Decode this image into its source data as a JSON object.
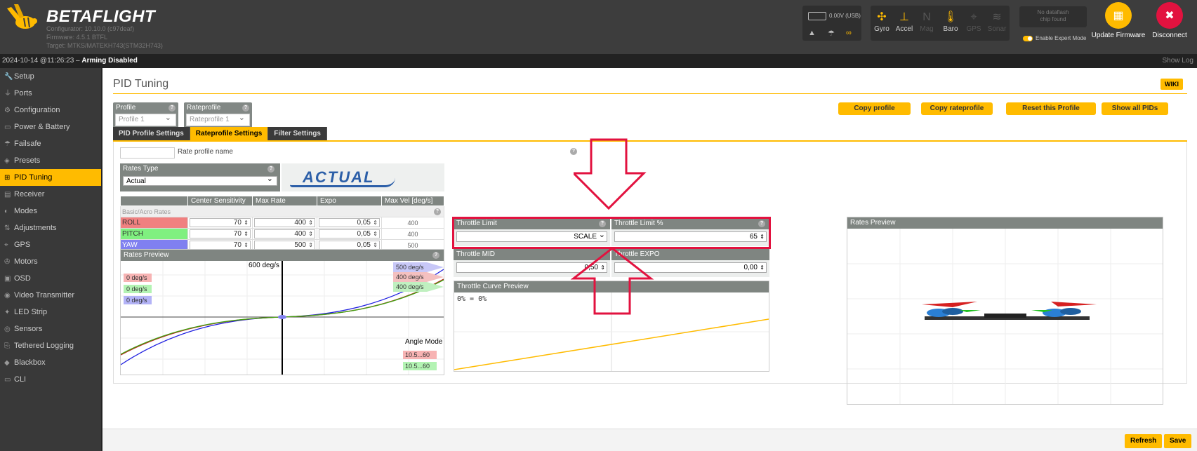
{
  "app": {
    "logo_text": "BETAFLIGHT",
    "configurator": "Configurator: 10.10.0 (c97deaf)",
    "firmware": "Firmware: 4.5.1 BTFL",
    "target": "Target: MTKS/MATEKH743(STM32H743)"
  },
  "battery": {
    "text": "0.00V (USB)"
  },
  "sensors": [
    {
      "label": "Gyro",
      "icon": "gyro-icon",
      "active": true
    },
    {
      "label": "Accel",
      "icon": "accel-icon",
      "active": true
    },
    {
      "label": "Mag",
      "icon": "mag-icon",
      "active": false
    },
    {
      "label": "Baro",
      "icon": "baro-icon",
      "active": true
    },
    {
      "label": "GPS",
      "icon": "gps-icon",
      "active": false
    },
    {
      "label": "Sonar",
      "icon": "sonar-icon",
      "active": false
    }
  ],
  "dataflash": {
    "line1": "No dataflash",
    "line2": "chip found"
  },
  "expert_mode": {
    "label": "Enable Expert Mode"
  },
  "header_buttons": {
    "update": "Update Firmware",
    "disconnect": "Disconnect"
  },
  "status": {
    "datetime": "2024-10-14 @11:26:23 –",
    "arming": "Arming Disabled",
    "show_log": "Show Log"
  },
  "sidebar": {
    "items": [
      {
        "label": "Setup",
        "icon": "wrench-icon"
      },
      {
        "label": "Ports",
        "icon": "plug-icon"
      },
      {
        "label": "Configuration",
        "icon": "gear-icon"
      },
      {
        "label": "Power & Battery",
        "icon": "battery-icon"
      },
      {
        "label": "Failsafe",
        "icon": "parachute-icon"
      },
      {
        "label": "Presets",
        "icon": "presets-icon"
      },
      {
        "label": "PID Tuning",
        "icon": "pid-icon",
        "active": true
      },
      {
        "label": "Receiver",
        "icon": "receiver-icon"
      },
      {
        "label": "Modes",
        "icon": "modes-icon"
      },
      {
        "label": "Adjustments",
        "icon": "adjustments-icon"
      },
      {
        "label": "GPS",
        "icon": "gps-icon"
      },
      {
        "label": "Motors",
        "icon": "motor-icon"
      },
      {
        "label": "OSD",
        "icon": "osd-icon"
      },
      {
        "label": "Video Transmitter",
        "icon": "vtx-icon"
      },
      {
        "label": "LED Strip",
        "icon": "led-icon"
      },
      {
        "label": "Sensors",
        "icon": "sensors-icon"
      },
      {
        "label": "Tethered Logging",
        "icon": "tethered-icon"
      },
      {
        "label": "Blackbox",
        "icon": "blackbox-icon"
      },
      {
        "label": "CLI",
        "icon": "cli-icon"
      }
    ]
  },
  "page": {
    "title": "PID Tuning",
    "wiki": "WIKI"
  },
  "profile": {
    "label": "Profile",
    "value": "Profile 1"
  },
  "rateprofile": {
    "label": "Rateprofile",
    "value": "Rateprofile 1"
  },
  "actions": {
    "copy_profile": "Copy profile",
    "copy_rateprofile": "Copy rateprofile",
    "reset_profile": "Reset this Profile",
    "show_all_pids": "Show all PIDs"
  },
  "tabs": [
    {
      "label": "PID Profile Settings"
    },
    {
      "label": "Rateprofile Settings",
      "active": true
    },
    {
      "label": "Filter Settings"
    }
  ],
  "rate_profile_name": {
    "label": "Rate profile name",
    "value": ""
  },
  "rates_type": {
    "label": "Rates Type",
    "value": "Actual",
    "logo": "ACTUAL"
  },
  "rates_table": {
    "headers": [
      "",
      "Center Sensitivity",
      "Max Rate",
      "Expo",
      "Max Vel [deg/s]"
    ],
    "group": "Basic/Acro Rates",
    "rows": [
      {
        "axis": "ROLL",
        "center": "70",
        "max_rate": "400",
        "expo": "0,05",
        "max_vel": "400"
      },
      {
        "axis": "PITCH",
        "center": "70",
        "max_rate": "400",
        "expo": "0,05",
        "max_vel": "400"
      },
      {
        "axis": "YAW",
        "center": "70",
        "max_rate": "500",
        "expo": "0,05",
        "max_vel": "500"
      }
    ]
  },
  "rates_preview": {
    "label": "Rates Preview",
    "center_label": "600 deg/s",
    "left_values": [
      "0 deg/s",
      "0 deg/s",
      "0 deg/s"
    ],
    "right_values": [
      "500 deg/s",
      "400 deg/s",
      "400 deg/s"
    ],
    "angle_mode_label": "Angle Mode",
    "angle_values": [
      "10.5...60",
      "10.5...60"
    ]
  },
  "throttle": {
    "limit_label": "Throttle Limit",
    "limit_value": "SCALE",
    "limit_pct_label": "Throttle Limit %",
    "limit_pct_value": "65",
    "mid_label": "Throttle MID",
    "mid_value": "0,50",
    "expo_label": "Throttle EXPO",
    "expo_value": "0,00",
    "curve_label": "Throttle Curve Preview",
    "curve_text": "0% = 0%"
  },
  "model_preview": {
    "label": "Rates Preview"
  },
  "footer": {
    "refresh": "Refresh",
    "save": "Save"
  },
  "colors": {
    "accent": "#ffbb00",
    "annotation": "#e2123f",
    "roll": "#f08080",
    "pitch": "#80f080",
    "yaw": "#8080f0"
  },
  "chart_data": [
    {
      "type": "line",
      "title": "Rates Preview",
      "series": [
        {
          "name": "ROLL",
          "max_rate": 400
        },
        {
          "name": "PITCH",
          "max_rate": 400
        },
        {
          "name": "YAW",
          "max_rate": 500
        }
      ],
      "ylim": [
        -600,
        600
      ]
    },
    {
      "type": "line",
      "title": "Throttle Curve Preview",
      "x": [
        0,
        100
      ],
      "y": [
        0,
        65
      ]
    }
  ]
}
